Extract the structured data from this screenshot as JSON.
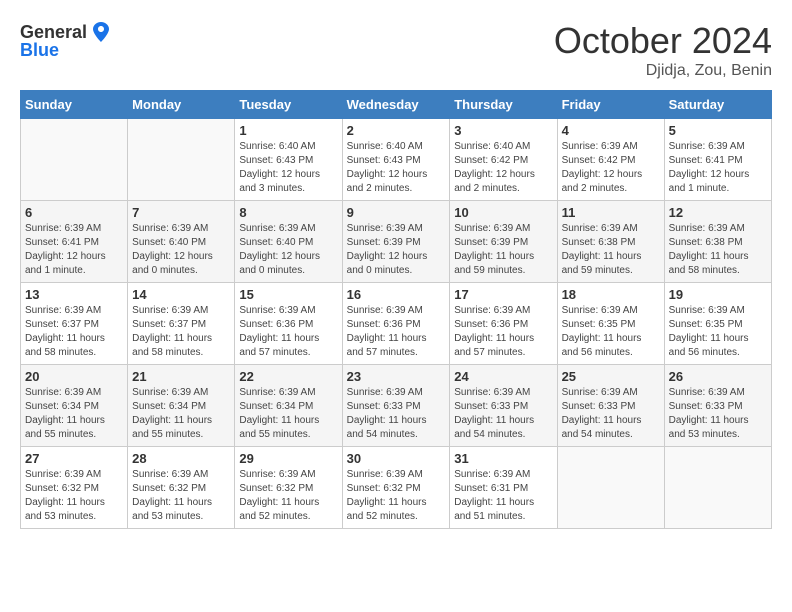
{
  "header": {
    "logo_general": "General",
    "logo_blue": "Blue",
    "month_year": "October 2024",
    "location": "Djidja, Zou, Benin"
  },
  "days_of_week": [
    "Sunday",
    "Monday",
    "Tuesday",
    "Wednesday",
    "Thursday",
    "Friday",
    "Saturday"
  ],
  "weeks": [
    [
      {
        "day": "",
        "detail": ""
      },
      {
        "day": "",
        "detail": ""
      },
      {
        "day": "1",
        "detail": "Sunrise: 6:40 AM\nSunset: 6:43 PM\nDaylight: 12 hours and 3 minutes."
      },
      {
        "day": "2",
        "detail": "Sunrise: 6:40 AM\nSunset: 6:43 PM\nDaylight: 12 hours and 2 minutes."
      },
      {
        "day": "3",
        "detail": "Sunrise: 6:40 AM\nSunset: 6:42 PM\nDaylight: 12 hours and 2 minutes."
      },
      {
        "day": "4",
        "detail": "Sunrise: 6:39 AM\nSunset: 6:42 PM\nDaylight: 12 hours and 2 minutes."
      },
      {
        "day": "5",
        "detail": "Sunrise: 6:39 AM\nSunset: 6:41 PM\nDaylight: 12 hours and 1 minute."
      }
    ],
    [
      {
        "day": "6",
        "detail": "Sunrise: 6:39 AM\nSunset: 6:41 PM\nDaylight: 12 hours and 1 minute."
      },
      {
        "day": "7",
        "detail": "Sunrise: 6:39 AM\nSunset: 6:40 PM\nDaylight: 12 hours and 0 minutes."
      },
      {
        "day": "8",
        "detail": "Sunrise: 6:39 AM\nSunset: 6:40 PM\nDaylight: 12 hours and 0 minutes."
      },
      {
        "day": "9",
        "detail": "Sunrise: 6:39 AM\nSunset: 6:39 PM\nDaylight: 12 hours and 0 minutes."
      },
      {
        "day": "10",
        "detail": "Sunrise: 6:39 AM\nSunset: 6:39 PM\nDaylight: 11 hours and 59 minutes."
      },
      {
        "day": "11",
        "detail": "Sunrise: 6:39 AM\nSunset: 6:38 PM\nDaylight: 11 hours and 59 minutes."
      },
      {
        "day": "12",
        "detail": "Sunrise: 6:39 AM\nSunset: 6:38 PM\nDaylight: 11 hours and 58 minutes."
      }
    ],
    [
      {
        "day": "13",
        "detail": "Sunrise: 6:39 AM\nSunset: 6:37 PM\nDaylight: 11 hours and 58 minutes."
      },
      {
        "day": "14",
        "detail": "Sunrise: 6:39 AM\nSunset: 6:37 PM\nDaylight: 11 hours and 58 minutes."
      },
      {
        "day": "15",
        "detail": "Sunrise: 6:39 AM\nSunset: 6:36 PM\nDaylight: 11 hours and 57 minutes."
      },
      {
        "day": "16",
        "detail": "Sunrise: 6:39 AM\nSunset: 6:36 PM\nDaylight: 11 hours and 57 minutes."
      },
      {
        "day": "17",
        "detail": "Sunrise: 6:39 AM\nSunset: 6:36 PM\nDaylight: 11 hours and 57 minutes."
      },
      {
        "day": "18",
        "detail": "Sunrise: 6:39 AM\nSunset: 6:35 PM\nDaylight: 11 hours and 56 minutes."
      },
      {
        "day": "19",
        "detail": "Sunrise: 6:39 AM\nSunset: 6:35 PM\nDaylight: 11 hours and 56 minutes."
      }
    ],
    [
      {
        "day": "20",
        "detail": "Sunrise: 6:39 AM\nSunset: 6:34 PM\nDaylight: 11 hours and 55 minutes."
      },
      {
        "day": "21",
        "detail": "Sunrise: 6:39 AM\nSunset: 6:34 PM\nDaylight: 11 hours and 55 minutes."
      },
      {
        "day": "22",
        "detail": "Sunrise: 6:39 AM\nSunset: 6:34 PM\nDaylight: 11 hours and 55 minutes."
      },
      {
        "day": "23",
        "detail": "Sunrise: 6:39 AM\nSunset: 6:33 PM\nDaylight: 11 hours and 54 minutes."
      },
      {
        "day": "24",
        "detail": "Sunrise: 6:39 AM\nSunset: 6:33 PM\nDaylight: 11 hours and 54 minutes."
      },
      {
        "day": "25",
        "detail": "Sunrise: 6:39 AM\nSunset: 6:33 PM\nDaylight: 11 hours and 54 minutes."
      },
      {
        "day": "26",
        "detail": "Sunrise: 6:39 AM\nSunset: 6:33 PM\nDaylight: 11 hours and 53 minutes."
      }
    ],
    [
      {
        "day": "27",
        "detail": "Sunrise: 6:39 AM\nSunset: 6:32 PM\nDaylight: 11 hours and 53 minutes."
      },
      {
        "day": "28",
        "detail": "Sunrise: 6:39 AM\nSunset: 6:32 PM\nDaylight: 11 hours and 53 minutes."
      },
      {
        "day": "29",
        "detail": "Sunrise: 6:39 AM\nSunset: 6:32 PM\nDaylight: 11 hours and 52 minutes."
      },
      {
        "day": "30",
        "detail": "Sunrise: 6:39 AM\nSunset: 6:32 PM\nDaylight: 11 hours and 52 minutes."
      },
      {
        "day": "31",
        "detail": "Sunrise: 6:39 AM\nSunset: 6:31 PM\nDaylight: 11 hours and 51 minutes."
      },
      {
        "day": "",
        "detail": ""
      },
      {
        "day": "",
        "detail": ""
      }
    ]
  ]
}
